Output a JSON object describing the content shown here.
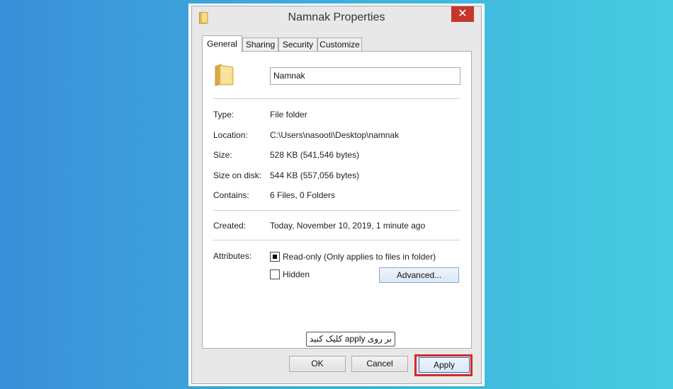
{
  "window": {
    "title": "Namnak Properties",
    "close_symbol": "✕"
  },
  "tabs": [
    {
      "label": "General",
      "active": true
    },
    {
      "label": "Sharing",
      "active": false
    },
    {
      "label": "Security",
      "active": false
    },
    {
      "label": "Customize",
      "active": false
    }
  ],
  "general": {
    "folder_name": "Namnak",
    "type_label": "Type:",
    "type_value": "File folder",
    "location_label": "Location:",
    "location_value": "C:\\Users\\nasooti\\Desktop\\namnak",
    "size_label": "Size:",
    "size_value": "528 KB (541,546 bytes)",
    "size_on_disk_label": "Size on disk:",
    "size_on_disk_value": "544 KB (557,056 bytes)",
    "contains_label": "Contains:",
    "contains_value": "6 Files, 0 Folders",
    "created_label": "Created:",
    "created_value": "Today, November 10, 2019, 1 minute ago",
    "attributes_label": "Attributes:",
    "readonly_label": "Read-only (Only applies to files in folder)",
    "readonly_state": "indeterminate",
    "hidden_label": "Hidden",
    "hidden_checked": false,
    "advanced_label": "Advanced..."
  },
  "annotation": {
    "text": "بر روی apply کلیک کنید"
  },
  "buttons": {
    "ok": "OK",
    "cancel": "Cancel",
    "apply": "Apply"
  },
  "icons": {
    "title": "folder-icon",
    "close": "close-icon",
    "folder": "folder-icon"
  },
  "colors": {
    "close_button": "#c7362b",
    "highlight": "#d62a2a",
    "background_left": "#3a8fd9",
    "background_right": "#45cbe0"
  }
}
